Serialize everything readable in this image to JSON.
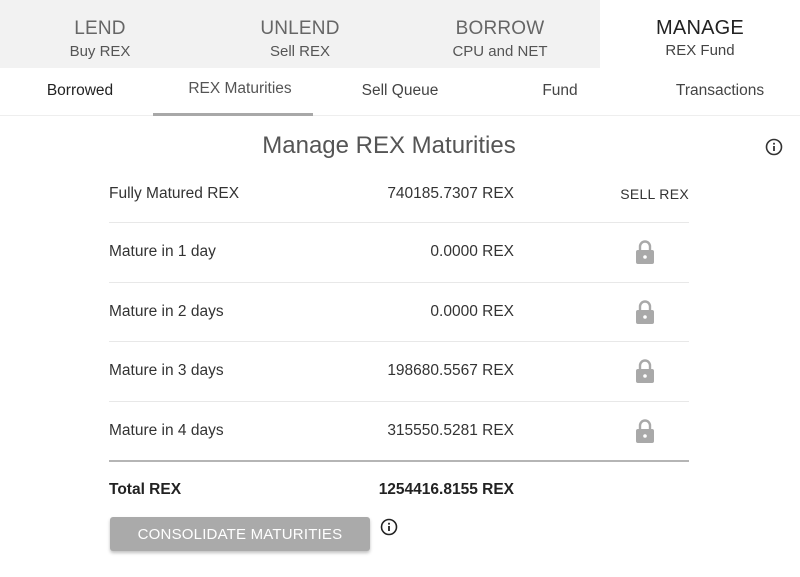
{
  "top_tabs": [
    {
      "title": "LEND",
      "subtitle": "Buy REX"
    },
    {
      "title": "UNLEND",
      "subtitle": "Sell REX"
    },
    {
      "title": "BORROW",
      "subtitle": "CPU and NET"
    },
    {
      "title": "MANAGE",
      "subtitle": "REX Fund"
    }
  ],
  "sub_tabs": [
    "Borrowed",
    "REX Maturities",
    "Sell Queue",
    "Fund",
    "Transactions"
  ],
  "active_top_tab": "MANAGE",
  "active_sub_tab": "REX Maturities",
  "page": {
    "title": "Manage REX Maturities"
  },
  "maturities": [
    {
      "label": "Fully Matured REX",
      "amount": "740185.7307 REX",
      "action": "SELL REX"
    },
    {
      "label": "Mature in 1 day",
      "amount": "0.0000 REX",
      "locked": true
    },
    {
      "label": "Mature in 2 days",
      "amount": "0.0000 REX",
      "locked": true
    },
    {
      "label": "Mature in 3 days",
      "amount": "198680.5567 REX",
      "locked": true
    },
    {
      "label": "Mature in 4 days",
      "amount": "315550.5281 REX",
      "locked": true
    }
  ],
  "total": {
    "label": "Total REX",
    "amount": "1254416.8155 REX"
  },
  "consolidate_button": {
    "label": "CONSOLIDATE MATURITIES"
  },
  "icons": {
    "info": "info-icon",
    "lock": "lock-icon"
  },
  "colors": {
    "tab_background": "#f2f2f2",
    "tab_indicator": "#a8a8a8",
    "button_background": "#aaaaaa",
    "lock_icon": "#a9a9a9"
  }
}
